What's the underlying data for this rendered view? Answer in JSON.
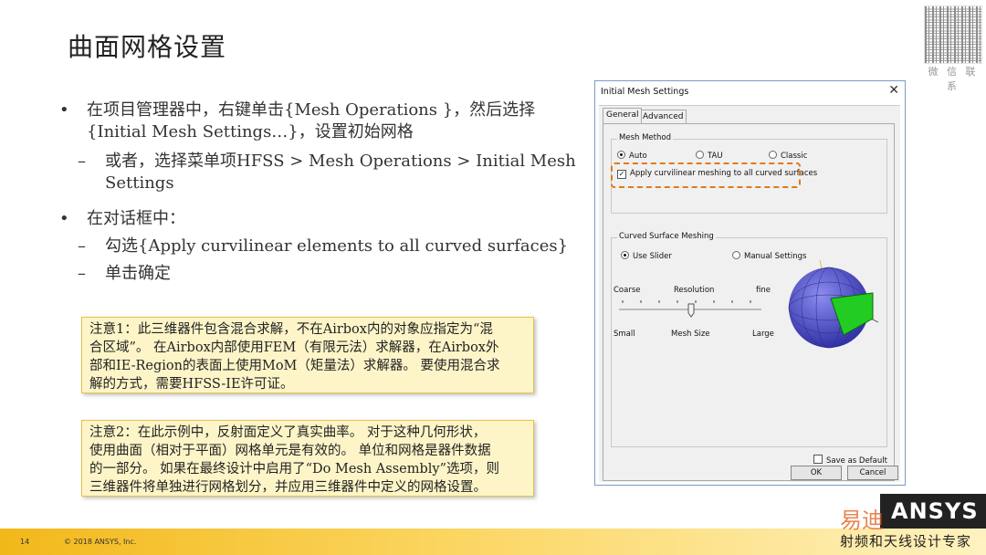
{
  "slide": {
    "title": "曲面网格设置",
    "qr_caption": "微 信 联 系",
    "page_number": "14",
    "copyright": "© 2018 ANSYS, Inc.",
    "logo_text": "ANSYS",
    "watermark_top": "易迪",
    "watermark_bottom": "射频和天线设计专家"
  },
  "bullets": [
    {
      "marker": "•",
      "line1": "在项目管理器中，右键单击{Mesh Operations }，然后选择",
      "line2": "{Initial Mesh Settings…}，设置初始网格"
    },
    {
      "marker": "–",
      "line1": "或者，选择菜单项HFSS > Mesh Operations > Initial Mesh",
      "line2": "Settings"
    },
    {
      "marker": "•",
      "line1": "在对话框中："
    },
    {
      "marker": "–",
      "line1": "勾选{Apply curvilinear elements to all curved surfaces}"
    },
    {
      "marker": "–",
      "line1": "单击确定"
    }
  ],
  "notes": [
    {
      "lines": [
        "注意1：此三维器件包含混合求解，不在Airbox内的对象应指定为“混",
        "合区域”。 在Airbox内部使用FEM（有限元法）求解器，在Airbox外",
        "部和IE-Region的表面上使用MoM（矩量法）求解器。 要使用混合求",
        "解的方式，需要HFSS-IE许可证。"
      ]
    },
    {
      "lines": [
        "注意2：在此示例中，反射面定义了真实曲率。 对于这种几何形状，",
        "使用曲面（相对于平面）网格单元是有效的。 单位和网格是器件数据",
        "的一部分。 如果在最终设计中启用了“Do Mesh Assembly”选项，则",
        "三维器件将单独进行网格划分，并应用三维器件中定义的网格设置。"
      ]
    }
  ],
  "dialog": {
    "title": "Initial Mesh Settings",
    "close": "✕",
    "tabs": [
      "General",
      "Advanced"
    ],
    "mesh_method": {
      "label": "Mesh Method",
      "options": [
        "Auto",
        "TAU",
        "Classic"
      ],
      "selected": "Auto"
    },
    "curvilinear": {
      "label": "Apply curvilinear meshing to all curved surfaces",
      "checked": true,
      "mark": "✓"
    },
    "curved_surface": {
      "label": "Curved Surface Meshing",
      "options": [
        "Use Slider",
        "Manual Settings"
      ],
      "selected": "Use Slider",
      "coarse": "Coarse",
      "resolution": "Resolution",
      "fine": "fine",
      "small": "Small",
      "mesh_size": "Mesh Size",
      "large": "Large",
      "slider_level": 0.5
    },
    "save_default": "Save as Default",
    "ok": "OK",
    "cancel": "Cancel"
  },
  "colors": {
    "highlight": "#e07a1a",
    "footer": "#f2b81a",
    "sphere": "#5a5ad8",
    "patch": "#22cc22"
  }
}
